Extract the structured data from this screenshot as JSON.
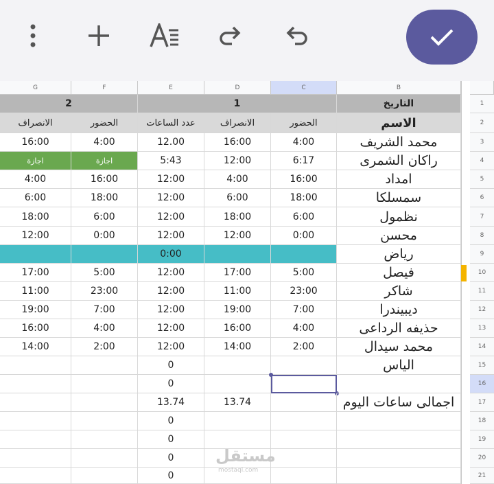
{
  "toolbar": {
    "icons": [
      "more-vertical-icon",
      "plus-icon",
      "text-format-icon",
      "redo-icon",
      "undo-icon"
    ],
    "confirm_icon": "check-icon",
    "accent": "#5b5a9e"
  },
  "columns": [
    "G",
    "F",
    "E",
    "D",
    "C",
    "B"
  ],
  "selected_column": "C",
  "selected_row": "16",
  "rows": [
    {
      "num": "1",
      "cells": [
        {
          "col": "GF",
          "v": "2",
          "style": "hdr"
        },
        {
          "col": "EDC",
          "v": "1",
          "style": "hdr"
        },
        {
          "col": "B",
          "v": "التاريخ",
          "style": "hdr"
        }
      ]
    },
    {
      "num": "2",
      "cells": [
        {
          "col": "G",
          "v": "الانصراف",
          "style": "sub"
        },
        {
          "col": "F",
          "v": "الحضور",
          "style": "sub"
        },
        {
          "col": "E",
          "v": "عدد الساعات",
          "style": "sub"
        },
        {
          "col": "D",
          "v": "الانصراف",
          "style": "sub"
        },
        {
          "col": "C",
          "v": "الحضور",
          "style": "sub"
        },
        {
          "col": "B",
          "v": "الاسم",
          "style": "sub-name"
        }
      ]
    },
    {
      "num": "3",
      "cells": [
        {
          "col": "G",
          "v": "16:00"
        },
        {
          "col": "F",
          "v": "4:00"
        },
        {
          "col": "E",
          "v": "12.00"
        },
        {
          "col": "D",
          "v": "16:00"
        },
        {
          "col": "C",
          "v": "4:00"
        },
        {
          "col": "B",
          "v": "محمد الشريف",
          "style": "name"
        }
      ]
    },
    {
      "num": "4",
      "cells": [
        {
          "col": "G",
          "v": "اجازة",
          "style": "green"
        },
        {
          "col": "F",
          "v": "اجازة",
          "style": "green"
        },
        {
          "col": "E",
          "v": "5:43"
        },
        {
          "col": "D",
          "v": "12:00"
        },
        {
          "col": "C",
          "v": "6:17"
        },
        {
          "col": "B",
          "v": "راكان الشمرى",
          "style": "name"
        }
      ]
    },
    {
      "num": "5",
      "cells": [
        {
          "col": "G",
          "v": "4:00"
        },
        {
          "col": "F",
          "v": "16:00"
        },
        {
          "col": "E",
          "v": "12:00"
        },
        {
          "col": "D",
          "v": "4:00"
        },
        {
          "col": "C",
          "v": "16:00"
        },
        {
          "col": "B",
          "v": "امداد",
          "style": "name"
        }
      ]
    },
    {
      "num": "6",
      "cells": [
        {
          "col": "G",
          "v": "6:00"
        },
        {
          "col": "F",
          "v": "18:00"
        },
        {
          "col": "E",
          "v": "12:00"
        },
        {
          "col": "D",
          "v": "6:00"
        },
        {
          "col": "C",
          "v": "18:00"
        },
        {
          "col": "B",
          "v": "سمسلكا",
          "style": "name"
        }
      ]
    },
    {
      "num": "7",
      "cells": [
        {
          "col": "G",
          "v": "18:00"
        },
        {
          "col": "F",
          "v": "6:00"
        },
        {
          "col": "E",
          "v": "12:00"
        },
        {
          "col": "D",
          "v": "18:00"
        },
        {
          "col": "C",
          "v": "6:00"
        },
        {
          "col": "B",
          "v": "نظمول",
          "style": "name"
        }
      ]
    },
    {
      "num": "8",
      "cells": [
        {
          "col": "G",
          "v": "12:00"
        },
        {
          "col": "F",
          "v": "0:00"
        },
        {
          "col": "E",
          "v": "12:00"
        },
        {
          "col": "D",
          "v": "12:00"
        },
        {
          "col": "C",
          "v": "0:00"
        },
        {
          "col": "B",
          "v": "محسن",
          "style": "name"
        }
      ]
    },
    {
      "num": "9",
      "cells": [
        {
          "col": "G",
          "v": "",
          "style": "teal"
        },
        {
          "col": "F",
          "v": "",
          "style": "teal"
        },
        {
          "col": "E",
          "v": "0:00",
          "style": "teal"
        },
        {
          "col": "D",
          "v": "",
          "style": "teal"
        },
        {
          "col": "C",
          "v": "",
          "style": "teal"
        },
        {
          "col": "B",
          "v": "رياض",
          "style": "name"
        }
      ]
    },
    {
      "num": "10",
      "cells": [
        {
          "col": "G",
          "v": "17:00"
        },
        {
          "col": "F",
          "v": "5:00"
        },
        {
          "col": "E",
          "v": "12:00"
        },
        {
          "col": "D",
          "v": "17:00"
        },
        {
          "col": "C",
          "v": "5:00"
        },
        {
          "col": "B",
          "v": "فيصل",
          "style": "name"
        }
      ]
    },
    {
      "num": "11",
      "cells": [
        {
          "col": "G",
          "v": "11:00"
        },
        {
          "col": "F",
          "v": "23:00"
        },
        {
          "col": "E",
          "v": "12:00"
        },
        {
          "col": "D",
          "v": "11:00"
        },
        {
          "col": "C",
          "v": "23:00"
        },
        {
          "col": "B",
          "v": "شاكر",
          "style": "name"
        }
      ]
    },
    {
      "num": "12",
      "cells": [
        {
          "col": "G",
          "v": "19:00"
        },
        {
          "col": "F",
          "v": "7:00"
        },
        {
          "col": "E",
          "v": "12:00"
        },
        {
          "col": "D",
          "v": "19:00"
        },
        {
          "col": "C",
          "v": "7:00"
        },
        {
          "col": "B",
          "v": "ديبيندرا",
          "style": "name"
        }
      ]
    },
    {
      "num": "13",
      "cells": [
        {
          "col": "G",
          "v": "16:00"
        },
        {
          "col": "F",
          "v": "4:00"
        },
        {
          "col": "E",
          "v": "12:00"
        },
        {
          "col": "D",
          "v": "16:00"
        },
        {
          "col": "C",
          "v": "4:00"
        },
        {
          "col": "B",
          "v": "حذيفه الرداعى",
          "style": "name"
        }
      ]
    },
    {
      "num": "14",
      "cells": [
        {
          "col": "G",
          "v": "14:00"
        },
        {
          "col": "F",
          "v": "2:00"
        },
        {
          "col": "E",
          "v": "12:00"
        },
        {
          "col": "D",
          "v": "14:00"
        },
        {
          "col": "C",
          "v": "2:00"
        },
        {
          "col": "B",
          "v": "محمد سيدال",
          "style": "name"
        }
      ]
    },
    {
      "num": "15",
      "cells": [
        {
          "col": "G",
          "v": ""
        },
        {
          "col": "F",
          "v": ""
        },
        {
          "col": "E",
          "v": "0"
        },
        {
          "col": "D",
          "v": ""
        },
        {
          "col": "C",
          "v": ""
        },
        {
          "col": "B",
          "v": "الياس",
          "style": "name"
        }
      ]
    },
    {
      "num": "16",
      "cells": [
        {
          "col": "G",
          "v": ""
        },
        {
          "col": "F",
          "v": ""
        },
        {
          "col": "E",
          "v": "0"
        },
        {
          "col": "D",
          "v": ""
        },
        {
          "col": "C",
          "v": "",
          "style": "selected"
        },
        {
          "col": "B",
          "v": ""
        }
      ]
    },
    {
      "num": "17",
      "cells": [
        {
          "col": "G",
          "v": ""
        },
        {
          "col": "F",
          "v": ""
        },
        {
          "col": "E",
          "v": "13.74"
        },
        {
          "col": "D",
          "v": "13.74"
        },
        {
          "col": "C",
          "v": ""
        },
        {
          "col": "B",
          "v": "اجمالى ساعات اليوم",
          "style": "name"
        }
      ]
    },
    {
      "num": "18",
      "cells": [
        {
          "col": "G",
          "v": ""
        },
        {
          "col": "F",
          "v": ""
        },
        {
          "col": "E",
          "v": "0"
        },
        {
          "col": "D",
          "v": ""
        },
        {
          "col": "C",
          "v": ""
        },
        {
          "col": "B",
          "v": ""
        }
      ]
    },
    {
      "num": "19",
      "cells": [
        {
          "col": "G",
          "v": ""
        },
        {
          "col": "F",
          "v": ""
        },
        {
          "col": "E",
          "v": "0"
        },
        {
          "col": "D",
          "v": ""
        },
        {
          "col": "C",
          "v": ""
        },
        {
          "col": "B",
          "v": ""
        }
      ]
    },
    {
      "num": "20",
      "cells": [
        {
          "col": "G",
          "v": ""
        },
        {
          "col": "F",
          "v": ""
        },
        {
          "col": "E",
          "v": "0"
        },
        {
          "col": "D",
          "v": ""
        },
        {
          "col": "C",
          "v": ""
        },
        {
          "col": "B",
          "v": ""
        }
      ]
    },
    {
      "num": "21",
      "cells": [
        {
          "col": "G",
          "v": ""
        },
        {
          "col": "F",
          "v": ""
        },
        {
          "col": "E",
          "v": "0"
        },
        {
          "col": "D",
          "v": ""
        },
        {
          "col": "C",
          "v": ""
        },
        {
          "col": "B",
          "v": ""
        }
      ]
    }
  ],
  "watermark": {
    "text": "مستقل",
    "sub": "mostaql.com"
  }
}
